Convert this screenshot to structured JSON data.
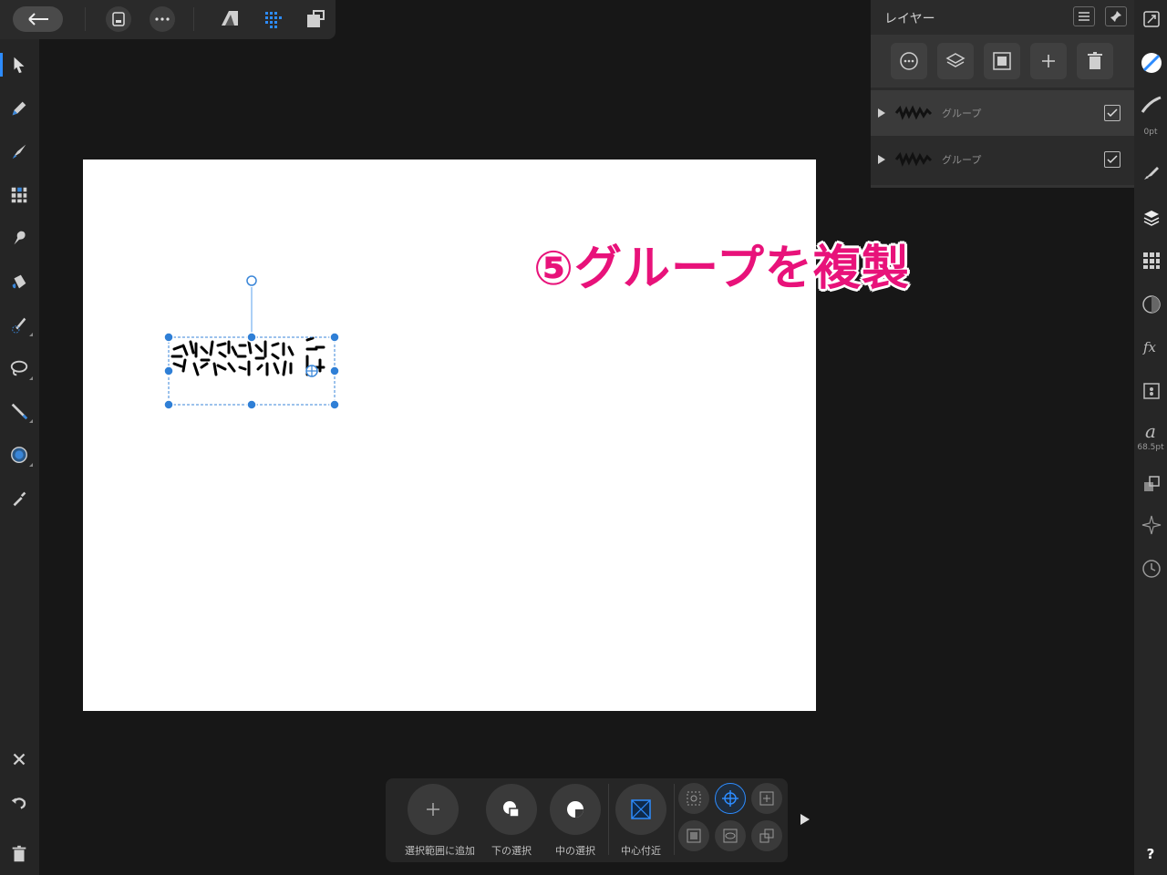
{
  "layers_panel": {
    "title": "レイヤー",
    "rows": [
      {
        "name": "グループ",
        "visible": true
      },
      {
        "name": "グループ",
        "visible": true
      }
    ]
  },
  "right_bar": {
    "stroke_width": "0pt",
    "font_size": "68.5pt",
    "help": "?"
  },
  "annotation": "⑤グループを複製",
  "context_toolbar": {
    "add_to_selection": "選択範囲に追加",
    "select_below": "下の選択",
    "select_inside": "中の選択",
    "near_center": "中心付近"
  },
  "colors": {
    "accent": "#2d8cff",
    "annotation": "#e8127a",
    "selection": "#1f7ae0"
  }
}
